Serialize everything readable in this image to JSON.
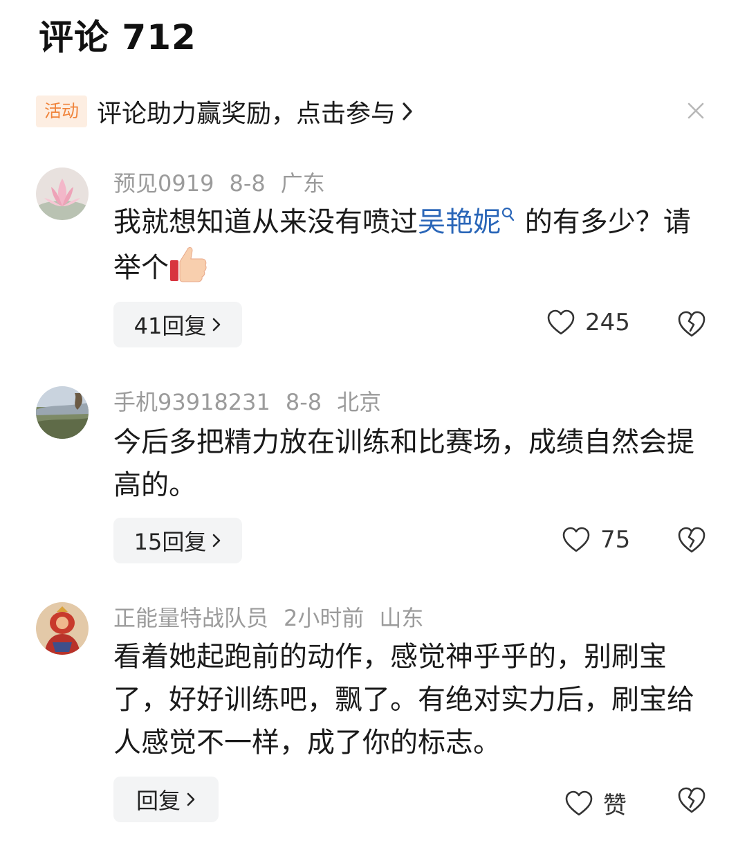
{
  "header": {
    "title": "评论 712"
  },
  "banner": {
    "badge": "活动",
    "text": "评论助力赢奖励，点击参与"
  },
  "comments": [
    {
      "user": "预见0919",
      "date": "8-8",
      "location": "广东",
      "text_before": "我就想知道从来没有喷过",
      "highlight": "吴艳妮",
      "text_after": " 的有多少？请举个",
      "reply_label": "41回复",
      "likes": "245"
    },
    {
      "user": "手机93918231",
      "date": "8-8",
      "location": "北京",
      "text": "今后多把精力放在训练和比赛场，成绩自然会提高的。",
      "reply_label": "15回复",
      "likes": "75"
    },
    {
      "user": "正能量特战队员",
      "date": "2小时前",
      "location": "山东",
      "text": "看着她起跑前的动作，感觉神乎乎的，别刷宝了，好好训练吧，飘了。有绝对实力后，刷宝给人感觉不一样，成了你的标志。",
      "reply_label": "回复",
      "likes": "赞"
    }
  ],
  "icons": {
    "close": "close-icon",
    "heart": "heart-icon",
    "broken_heart": "broken-heart-icon",
    "search": "search-icon",
    "thumbs_up": "thumbs-up-emoji"
  },
  "colors": {
    "accent_badge": "#f0843c",
    "badge_bg": "#fdeee2",
    "highlight": "#2a66b8",
    "meta": "#9b9b9b"
  }
}
